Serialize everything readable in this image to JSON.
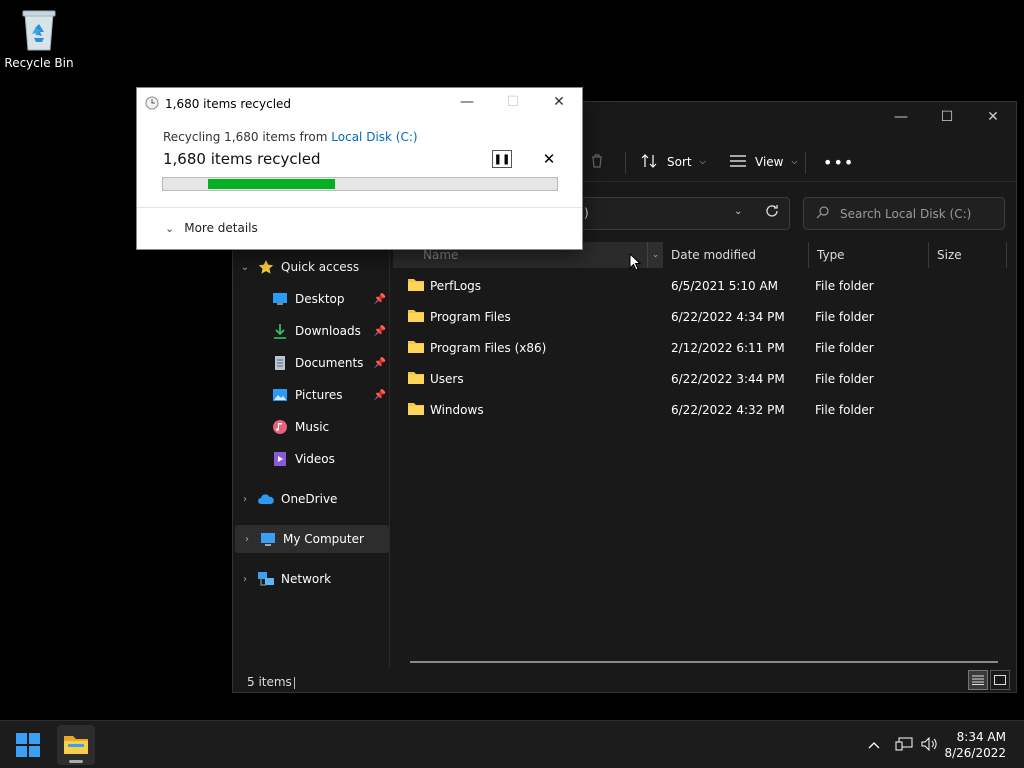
{
  "desktop": {
    "recycle_bin_label": "Recycle Bin"
  },
  "explorer": {
    "toolbar": {
      "sort_label": "Sort",
      "view_label": "View"
    },
    "address_partial": ")",
    "search_placeholder": "Search Local Disk (C:)",
    "nav": {
      "quick_access": "Quick access",
      "items": [
        "Desktop",
        "Downloads",
        "Documents",
        "Pictures",
        "Music",
        "Videos"
      ],
      "onedrive": "OneDrive",
      "my_computer": "My Computer",
      "network": "Network"
    },
    "columns": {
      "name": "Name",
      "date": "Date modified",
      "type": "Type",
      "size": "Size"
    },
    "rows": [
      {
        "name": "PerfLogs",
        "date": "6/5/2021 5:10 AM",
        "type": "File folder"
      },
      {
        "name": "Program Files",
        "date": "6/22/2022 4:34 PM",
        "type": "File folder"
      },
      {
        "name": "Program Files (x86)",
        "date": "2/12/2022 6:11 PM",
        "type": "File folder"
      },
      {
        "name": "Users",
        "date": "6/22/2022 3:44 PM",
        "type": "File folder"
      },
      {
        "name": "Windows",
        "date": "6/22/2022 4:32 PM",
        "type": "File folder"
      }
    ],
    "status": "5 items"
  },
  "dialog": {
    "title": "1,680 items recycled",
    "subtitle_prefix": "Recycling 1,680 items from ",
    "subtitle_link": "Local Disk (C:)",
    "main": "1,680 items recycled",
    "progress": {
      "start": 0.115,
      "end": 0.437
    },
    "more_details": "More details"
  },
  "taskbar": {
    "time": "8:34 AM",
    "date": "8/26/2022"
  },
  "colors": {
    "progress_green": "#06b025",
    "link_blue": "#0067c0",
    "folder_yellow": "#f5c842"
  }
}
